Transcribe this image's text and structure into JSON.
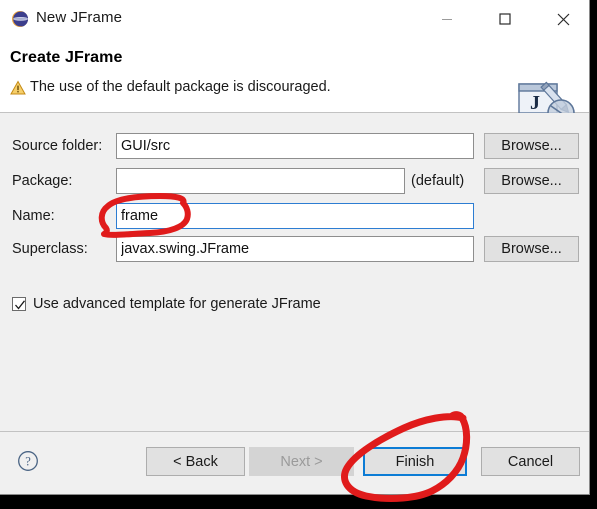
{
  "window": {
    "title": "New JFrame",
    "icon": "eclipse-icon",
    "controls": {
      "minimize": "minimize-icon",
      "maximize": "maximize-icon",
      "close": "close-icon"
    }
  },
  "header": {
    "title": "Create JFrame",
    "warning_icon": "warning-triangle-icon",
    "warning_text": "The use of the default package is discouraged.",
    "banner_icon": "jframe-banner-icon"
  },
  "form": {
    "rows": [
      {
        "label": "Source folder:",
        "value": "GUI/src",
        "placeholder": "",
        "browse_label": "Browse...",
        "has_browse": true,
        "focused": false
      },
      {
        "label": "Package:",
        "value": "",
        "placeholder": "",
        "note": "(default)",
        "browse_label": "Browse...",
        "has_browse": true,
        "focused": false
      },
      {
        "label": "Name:",
        "value": "frame",
        "placeholder": "",
        "browse_label": "",
        "has_browse": false,
        "focused": true
      },
      {
        "label": "Superclass:",
        "value": "javax.swing.JFrame",
        "placeholder": "",
        "browse_label": "Browse...",
        "has_browse": true,
        "focused": false
      }
    ],
    "checkbox": {
      "label": "Use advanced template for generate JFrame",
      "checked": true
    }
  },
  "footer": {
    "help_icon": "help-question-icon",
    "back_label": "< Back",
    "next_label": "Next >",
    "next_disabled": true,
    "finish_label": "Finish",
    "cancel_label": "Cancel"
  },
  "annotations": {
    "name_field_circle": "red-ellipse-around-frame-value",
    "finish_button_circle": "red-ellipse-around-finish-button",
    "color": "#e01b1b"
  },
  "colors": {
    "dialog_background": "#f0f0f0",
    "header_background": "#ffffff",
    "focus_border": "#0c7cd5",
    "annotation_red": "#e01b1b",
    "warning_yellow": "#f0b400"
  }
}
